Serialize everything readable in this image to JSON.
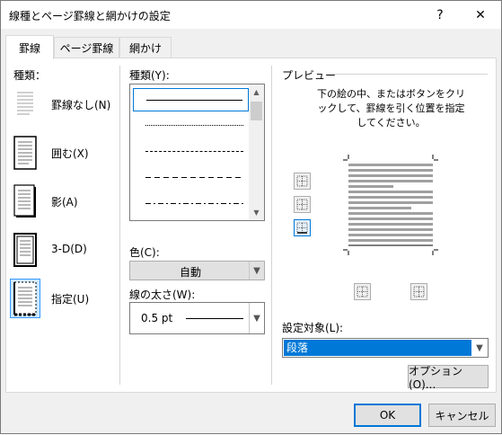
{
  "window": {
    "title": "線種とページ罫線と網かけの設定",
    "help_glyph": "?",
    "close_glyph": "✕"
  },
  "tabs": [
    {
      "label": "罫線",
      "active": true
    },
    {
      "label": "ページ罫線",
      "active": false
    },
    {
      "label": "網かけ",
      "active": false
    }
  ],
  "settings": {
    "heading": "種類：",
    "items": [
      {
        "label": "罫線なし(N)",
        "icon": "no-border-icon"
      },
      {
        "label": "囲む(X)",
        "icon": "box-border-icon"
      },
      {
        "label": "影(A)",
        "icon": "shadow-border-icon"
      },
      {
        "label": "3-D(D)",
        "icon": "3d-border-icon"
      },
      {
        "label": "指定(U)",
        "icon": "custom-border-icon",
        "selected": true
      }
    ]
  },
  "style": {
    "heading": "種類(Y):",
    "selected_index": 0
  },
  "color": {
    "label": "色(C):",
    "value": "自動"
  },
  "width": {
    "label": "線の太さ(W):",
    "value": "0.5 pt"
  },
  "preview": {
    "heading": "プレビュー",
    "instructions": "下の絵の中、またはボタンをクリックして、罫線を引く位置を指定してください。"
  },
  "apply_to": {
    "label": "設定対象(L):",
    "value": "段落"
  },
  "buttons": {
    "options": "オプション(O)...",
    "ok": "OK",
    "cancel": "キャンセル"
  },
  "colors": {
    "accent": "#0078d7",
    "selection_bg": "#cce8ff"
  }
}
